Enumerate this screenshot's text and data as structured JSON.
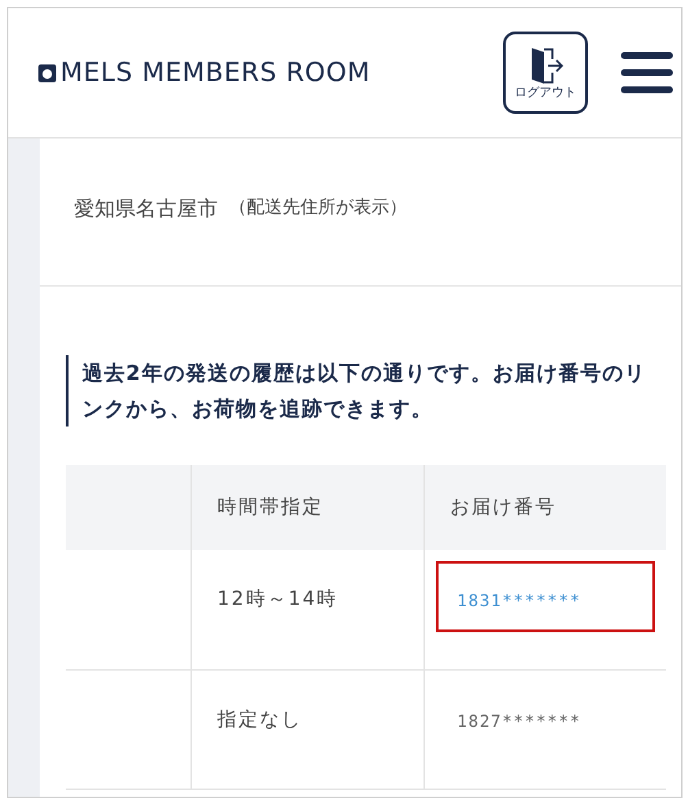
{
  "header": {
    "logo_text": "MELS MEMBERS ROOM",
    "logout_label": "ログアウト"
  },
  "address": {
    "text": "愛知県名古屋市",
    "note": "（配送先住所が表示）"
  },
  "notice": "過去2年の発送の履歴は以下の通りです。お届け番号のリンクから、お荷物を追跡できます。",
  "table": {
    "columns": [
      "時間帯指定",
      "お届け番号"
    ],
    "rows": [
      {
        "time": "12時～14時",
        "number": "1831*******",
        "kind": "link",
        "highlighted": true
      },
      {
        "time": "指定なし",
        "number": "1827*******",
        "kind": "plain",
        "highlighted": false
      }
    ]
  }
}
